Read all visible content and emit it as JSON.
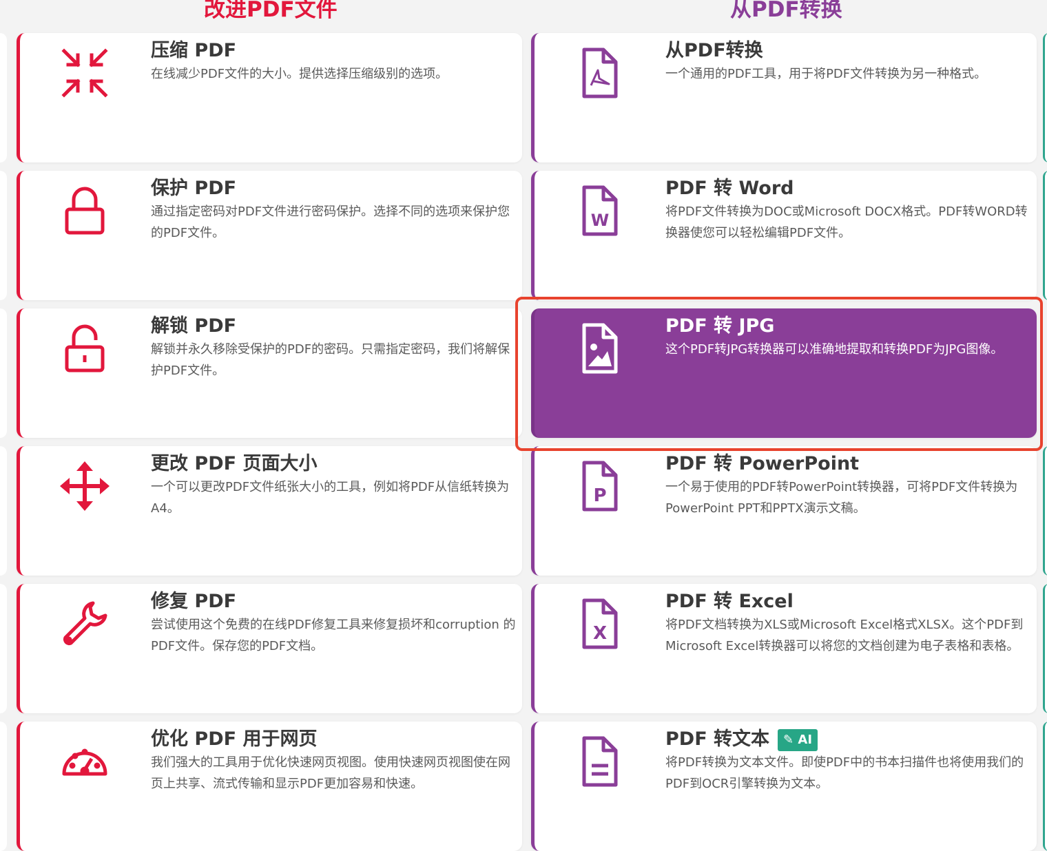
{
  "columns": {
    "left_title": "改进PDF文件",
    "right_title": "从PDF转换"
  },
  "colors": {
    "red_accent": "#e2173c",
    "purple_accent": "#8a3e98",
    "highlight_border": "#e8432e",
    "ai_badge": "#27a686"
  },
  "left_cards": [
    {
      "icon": "compress-icon",
      "title": "压缩 PDF",
      "desc": "在线减少PDF文件的大小。提供选择压缩级别的选项。"
    },
    {
      "icon": "lock-icon",
      "title": "保护 PDF",
      "desc": "通过指定密码对PDF文件进行密码保护。选择不同的选项来保护您的PDF文件。"
    },
    {
      "icon": "unlock-icon",
      "title": "解锁 PDF",
      "desc": "解锁并永久移除受保护的PDF的密码。只需指定密码，我们将解保护PDF文件。"
    },
    {
      "icon": "move-arrows-icon",
      "title": "更改 PDF 页面大小",
      "desc": "一个可以更改PDF文件纸张大小的工具，例如将PDF从信纸转换为A4。"
    },
    {
      "icon": "wrench-icon",
      "title": "修复 PDF",
      "desc": "尝试使用这个免费的在线PDF修复工具来修复损坏和corruption 的PDF文件。保存您的PDF文档。"
    },
    {
      "icon": "speedometer-icon",
      "title": "优化 PDF 用于网页",
      "desc": "我们强大的工具用于优化快速网页视图。使用快速网页视图使在网页上共享、流式传输和显示PDF更加容易和快速。"
    }
  ],
  "right_cards": [
    {
      "icon": "pdf-file-icon",
      "title": "从PDF转换",
      "desc": "一个通用的PDF工具，用于将PDF文件转换为另一种格式。"
    },
    {
      "icon": "word-file-icon",
      "title": "PDF 转 Word",
      "desc": "将PDF文件转换为DOC或Microsoft DOCX格式。PDF转WORD转换器使您可以轻松编辑PDF文件。"
    },
    {
      "icon": "image-file-icon",
      "title": "PDF 转 JPG",
      "desc": "这个PDF转JPG转换器可以准确地提取和转换PDF为JPG图像。"
    },
    {
      "icon": "powerpoint-file-icon",
      "title": "PDF 转 PowerPoint",
      "desc": "一个易于使用的PDF转PowerPoint转换器，可将PDF文件转换为PowerPoint PPT和PPTX演示文稿。"
    },
    {
      "icon": "excel-file-icon",
      "title": "PDF 转 Excel",
      "desc": "将PDF文档转换为XLS或Microsoft Excel格式XLSX。这个PDF到Microsoft Excel转换器可以将您的文档创建为电子表格和表格。"
    },
    {
      "icon": "text-file-icon",
      "title": "PDF 转文本",
      "desc": "将PDF转换为文本文件。即使PDF中的书本扫描件也将使用我们的PDF到OCR引擎转换为文本。",
      "badge": "AI"
    }
  ]
}
